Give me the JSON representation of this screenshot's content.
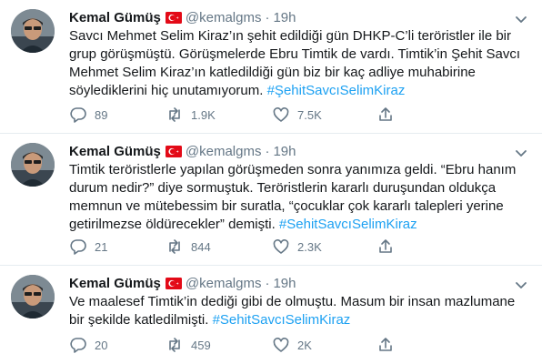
{
  "tweets": [
    {
      "author_name": "Kemal Gümüş",
      "handle": "@kemalgms",
      "separator": "·",
      "time": "19h",
      "text": "Savcı Mehmet Selim Kiraz’ın şehit edildiği gün DHKP-C’li teröristler ile bir grup görüşmüştü. Görüşmelerde Ebru Timtik de vardı. Timtik’in Şehit Savcı Mehmet Selim Kiraz’ın katledildiği gün biz bir kaç adliye muhabirine söylediklerini hiç unutamıyorum. ",
      "hashtag": "#ŞehitSavcıSelimKiraz",
      "replies": "89",
      "retweets": "1.9K",
      "likes": "7.5K"
    },
    {
      "author_name": "Kemal Gümüş",
      "handle": "@kemalgms",
      "separator": "·",
      "time": "19h",
      "text": "Timtik teröristlerle yapılan görüşmeden sonra yanımıza geldi. “Ebru hanım durum nedir?” diye sormuştuk. Teröristlerin kararlı duruşundan oldukça memnun ve mütebessim bir suratla, “çocuklar çok kararlı talepleri yerine getirilmezse öldürecekler” demişti. ",
      "hashtag": "#SehitSavcıSelimKiraz",
      "replies": "21",
      "retweets": "844",
      "likes": "2.3K"
    },
    {
      "author_name": "Kemal Gümüş",
      "handle": "@kemalgms",
      "separator": "·",
      "time": "19h",
      "text": "Ve maalesef Timtik’in dediği gibi de olmuştu. Masum bir insan mazlumane bir şekilde katledilmişti. ",
      "hashtag": "#SehitSavcıSelimKiraz",
      "replies": "20",
      "retweets": "459",
      "likes": "2K"
    }
  ],
  "icons": {
    "flag": "turkey-flag-icon",
    "caret": "chevron-down-icon",
    "reply": "reply-icon",
    "retweet": "retweet-icon",
    "like": "heart-icon",
    "share": "share-icon"
  },
  "colors": {
    "text": "#14171a",
    "muted": "#657786",
    "link": "#1da1f2",
    "border": "#e6ecf0",
    "flag_red": "#e30a17"
  }
}
